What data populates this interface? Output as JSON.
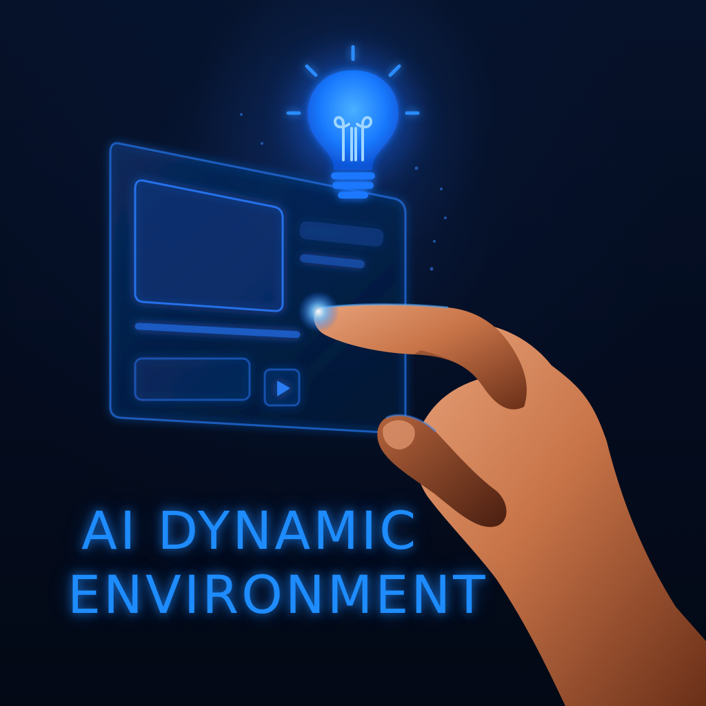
{
  "headline": {
    "line1": "AI DYNAMIC",
    "line2": "ENVIRONMENT"
  },
  "icons": {
    "bulb": "lightbulb-icon",
    "play": "play-icon"
  },
  "colors": {
    "background": "#030a18",
    "accent": "#1e8cff",
    "glow": "#4aa8ff",
    "skin": "#c8754a"
  }
}
